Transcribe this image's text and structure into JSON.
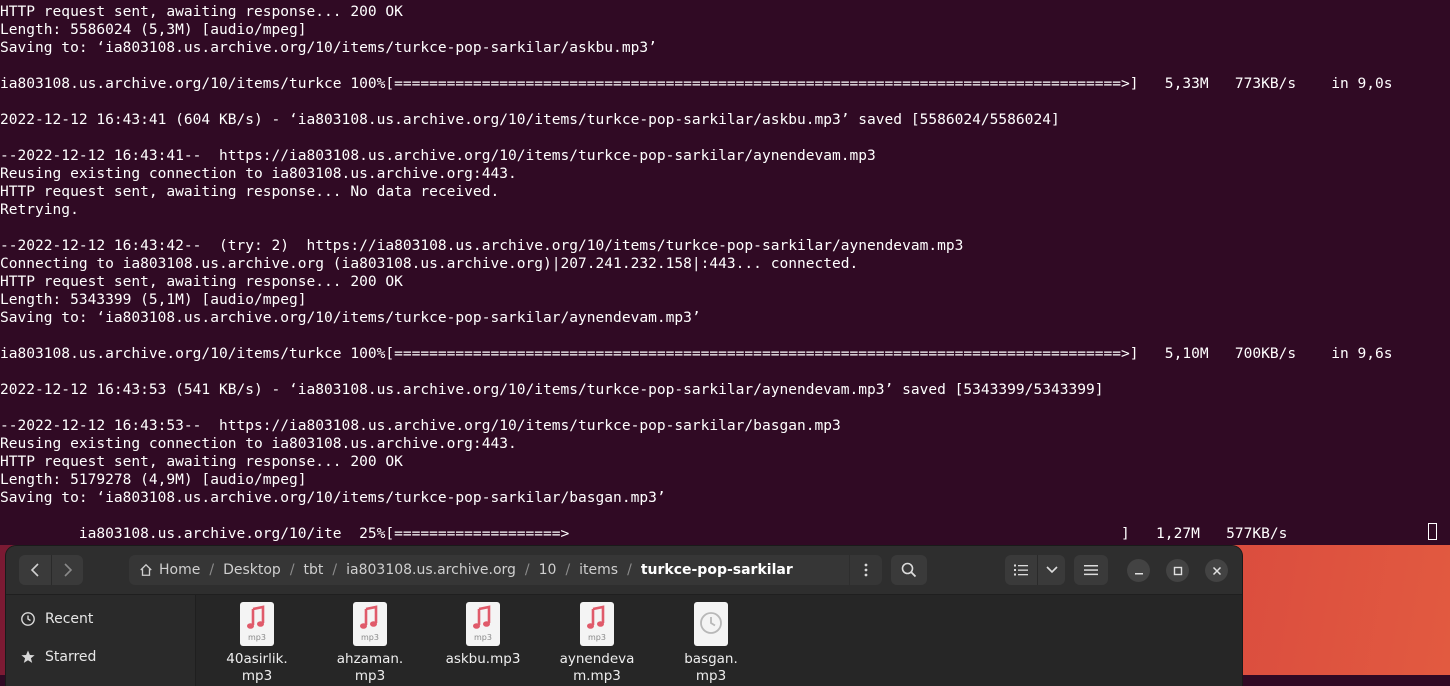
{
  "terminal": {
    "lines": [
      "HTTP request sent, awaiting response... 200 OK",
      "Length: 5586024 (5,3M) [audio/mpeg]",
      "Saving to: ‘ia803108.us.archive.org/10/items/turkce-pop-sarkilar/askbu.mp3’",
      "",
      "ia803108.us.archive.org/10/items/turkce 100%[===================================================================================>]   5,33M   773KB/s    in 9,0s",
      "",
      "2022-12-12 16:43:41 (604 KB/s) - ‘ia803108.us.archive.org/10/items/turkce-pop-sarkilar/askbu.mp3’ saved [5586024/5586024]",
      "",
      "--2022-12-12 16:43:41--  https://ia803108.us.archive.org/10/items/turkce-pop-sarkilar/aynendevam.mp3",
      "Reusing existing connection to ia803108.us.archive.org:443.",
      "HTTP request sent, awaiting response... No data received.",
      "Retrying.",
      "",
      "--2022-12-12 16:43:42--  (try: 2)  https://ia803108.us.archive.org/10/items/turkce-pop-sarkilar/aynendevam.mp3",
      "Connecting to ia803108.us.archive.org (ia803108.us.archive.org)|207.241.232.158|:443... connected.",
      "HTTP request sent, awaiting response... 200 OK",
      "Length: 5343399 (5,1M) [audio/mpeg]",
      "Saving to: ‘ia803108.us.archive.org/10/items/turkce-pop-sarkilar/aynendevam.mp3’",
      "",
      "ia803108.us.archive.org/10/items/turkce 100%[===================================================================================>]   5,10M   700KB/s    in 9,6s",
      "",
      "2022-12-12 16:43:53 (541 KB/s) - ‘ia803108.us.archive.org/10/items/turkce-pop-sarkilar/aynendevam.mp3’ saved [5343399/5343399]",
      "",
      "--2022-12-12 16:43:53--  https://ia803108.us.archive.org/10/items/turkce-pop-sarkilar/basgan.mp3",
      "Reusing existing connection to ia803108.us.archive.org:443.",
      "HTTP request sent, awaiting response... 200 OK",
      "Length: 5179278 (4,9M) [audio/mpeg]",
      "Saving to: ‘ia803108.us.archive.org/10/items/turkce-pop-sarkilar/basgan.mp3’",
      "",
      "         ia803108.us.archive.org/10/ite  25%[===================>                                                               ]   1,27M   577KB/s"
    ],
    "colors": {
      "background": "#300a24",
      "foreground": "#ffffff"
    }
  },
  "files": {
    "nav": {
      "back_icon": "chevron-left-icon",
      "forward_icon": "chevron-right-icon"
    },
    "breadcrumb": {
      "home_icon": "home-icon",
      "items": [
        "Home",
        "Desktop",
        "tbt",
        "ia803108.us.archive.org",
        "10",
        "items",
        "turkce-pop-sarkilar"
      ]
    },
    "sidebar": {
      "items": [
        {
          "label": "Recent",
          "icon": "clock-icon"
        },
        {
          "label": "Starred",
          "icon": "star-icon"
        }
      ]
    },
    "items": [
      {
        "name": "40asirlik.\nmp3",
        "badge": "mp3",
        "type": "audio"
      },
      {
        "name": "ahzaman.\nmp3",
        "badge": "mp3",
        "type": "audio"
      },
      {
        "name": "askbu.mp3",
        "badge": "mp3",
        "type": "audio"
      },
      {
        "name": "aynendeva\nm.mp3",
        "badge": "mp3",
        "type": "audio"
      },
      {
        "name": "basgan.\nmp3",
        "badge": "",
        "type": "pending"
      }
    ],
    "colors": {
      "music_accent": "#e05a6a",
      "window_bg": "#2a2a2a"
    }
  }
}
